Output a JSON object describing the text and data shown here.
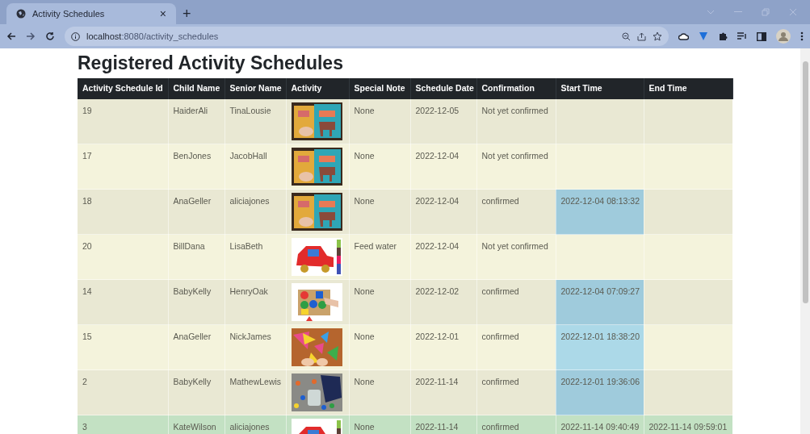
{
  "browser": {
    "tab_title": "Activity Schedules",
    "tab_close": "×",
    "new_tab": "+",
    "url_host": "localhost",
    "url_path": ":8080/activity_schedules"
  },
  "page": {
    "title": "Registered Activity Schedules"
  },
  "table": {
    "columns": [
      "Activity Schedule Id",
      "Child Name",
      "Senior Name",
      "Activity",
      "Special Note",
      "Schedule Date",
      "Confirmation",
      "Start Time",
      "End Time"
    ],
    "rows": [
      {
        "id": "19",
        "child": "HaiderAli",
        "senior": "TinaLousie",
        "note": "None",
        "date": "2022-12-05",
        "confirmation": "Not yet confirmed",
        "start_highlighted": false,
        "completed": false
      },
      {
        "id": "17",
        "child": "BenJones",
        "senior": "JacobHall",
        "note": "None",
        "date": "2022-12-04",
        "confirmation": "Not yet confirmed",
        "start_highlighted": false,
        "completed": false
      },
      {
        "id": "18",
        "child": "AnaGeller",
        "senior": "aliciajones",
        "note": "None",
        "date": "2022-12-04",
        "confirmation": "confirmed",
        "start": "2022-12-04 08:13:32",
        "start_highlighted": true,
        "completed": false
      },
      {
        "id": "20",
        "child": "BillDana",
        "senior": "LisaBeth",
        "note": "Feed water",
        "date": "2022-12-04",
        "confirmation": "Not yet confirmed",
        "start_highlighted": false,
        "completed": false
      },
      {
        "id": "14",
        "child": "BabyKelly",
        "senior": "HenryOak",
        "note": "None",
        "date": "2022-12-02",
        "confirmation": "confirmed",
        "start": "2022-12-04 07:09:27",
        "start_highlighted": true,
        "completed": false
      },
      {
        "id": "15",
        "child": "AnaGeller",
        "senior": "NickJames",
        "note": "None",
        "date": "2022-12-01",
        "confirmation": "confirmed",
        "start": "2022-12-01 18:38:20",
        "start_highlighted": true,
        "completed": false
      },
      {
        "id": "2",
        "child": "BabyKelly",
        "senior": "MathewLewis",
        "note": "None",
        "date": "2022-11-14",
        "confirmation": "confirmed",
        "start": "2022-12-01 19:36:06",
        "start_highlighted": true,
        "completed": false
      },
      {
        "id": "3",
        "child": "KateWilson",
        "senior": "aliciajones",
        "note": "None",
        "date": "2022-11-14",
        "confirmation": "confirmed",
        "start": "2022-11-14 09:40:49",
        "end": "2022-11-14 09:59:01",
        "start_highlighted": false,
        "completed": true
      }
    ]
  }
}
